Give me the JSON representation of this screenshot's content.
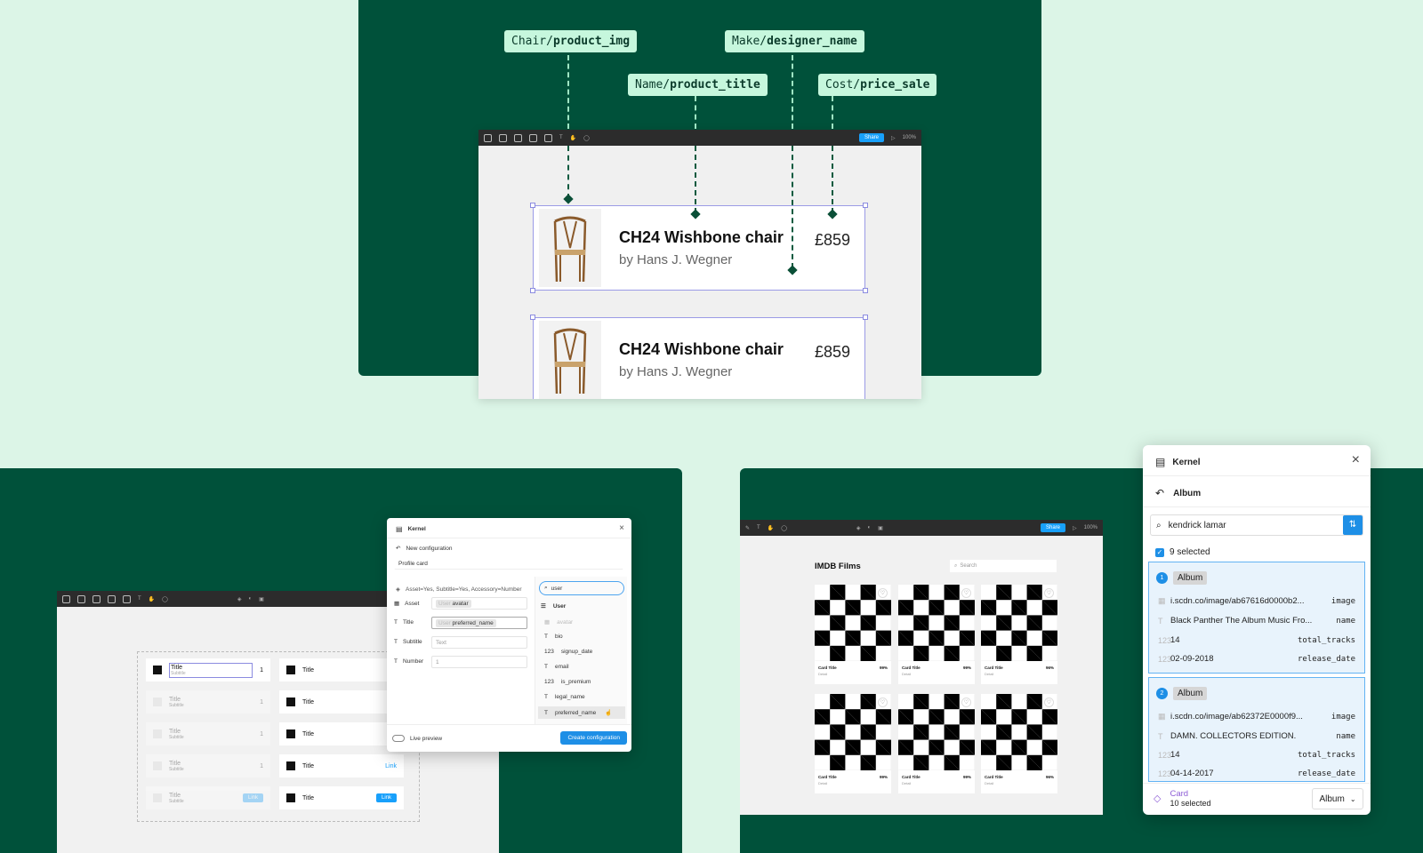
{
  "top": {
    "tags": {
      "product_img": {
        "prefix": "Chair/",
        "field": "product_img"
      },
      "designer_name": {
        "prefix": "Make/",
        "field": "designer_name"
      },
      "product_title": {
        "prefix": "Name/",
        "field": "product_title"
      },
      "price_sale": {
        "prefix": "Cost/",
        "field": "price_sale"
      }
    },
    "toolbar": {
      "share": "Share",
      "zoom": "100%"
    },
    "cards": [
      {
        "title": "CH24 Wishbone chair",
        "designer": "by Hans J. Wegner",
        "price": "£859"
      },
      {
        "title": "CH24 Wishbone chair",
        "designer": "by Hans J. Wegner",
        "price": "£859"
      }
    ]
  },
  "bottom_left": {
    "list": {
      "rows_left": [
        {
          "title": "Title",
          "subtitle": "Subtitle",
          "number": "1"
        },
        {
          "title": "Title",
          "subtitle": "Subtitle",
          "number": "1"
        },
        {
          "title": "Title",
          "subtitle": "Subtitle",
          "number": "1"
        },
        {
          "title": "Title",
          "subtitle": "Subtitle",
          "number": "1"
        },
        {
          "title": "Title",
          "subtitle": "Subtitle",
          "link": "Link"
        }
      ],
      "rows_right": [
        {
          "title": "Title"
        },
        {
          "title": "Title"
        },
        {
          "title": "Title"
        },
        {
          "title": "Title",
          "link": "Link"
        },
        {
          "title": "Title",
          "link": "Link"
        }
      ]
    },
    "kernel": {
      "title": "Kernel",
      "back_label": "New configuration",
      "config_name": "Profile card",
      "variant": "Asset=Yes, Subtitle=Yes, Accessory=Number",
      "fields": [
        {
          "label": "Asset",
          "chip_prefix": "User",
          "chip": "avatar"
        },
        {
          "label": "Title",
          "chip_prefix": "User",
          "chip": "preferred_name"
        },
        {
          "label": "Subtitle",
          "placeholder": "Text"
        },
        {
          "label": "Number",
          "placeholder": "1"
        }
      ],
      "search_value": "user",
      "group": "User",
      "properties": [
        {
          "icon": "▦",
          "name": "avatar",
          "dim": true
        },
        {
          "icon": "T",
          "name": "bio"
        },
        {
          "icon": "123",
          "name": "signup_date"
        },
        {
          "icon": "T",
          "name": "email"
        },
        {
          "icon": "123",
          "name": "is_premium"
        },
        {
          "icon": "T",
          "name": "legal_name"
        },
        {
          "icon": "T",
          "name": "preferred_name"
        }
      ],
      "live_preview": "Live preview",
      "create": "Create configuration"
    }
  },
  "bottom_right": {
    "window": {
      "title": "IMDB Films",
      "search_placeholder": "Search",
      "share": "Share",
      "zoom": "100%"
    },
    "films": [
      {
        "title": "Card Title",
        "sub": "Detail",
        "pct": "99%"
      },
      {
        "title": "Card Title",
        "sub": "Detail",
        "pct": "99%"
      },
      {
        "title": "Card Title",
        "sub": "Detail",
        "pct": "96%"
      },
      {
        "title": "Card Title",
        "sub": "Detail",
        "pct": "99%"
      },
      {
        "title": "Card Title",
        "sub": "Detail",
        "pct": "99%"
      },
      {
        "title": "Card Title",
        "sub": "Detail",
        "pct": "96%"
      }
    ],
    "kernel": {
      "title": "Kernel",
      "back_label": "Album",
      "search_value": "kendrick lamar",
      "selected": "9 selected",
      "records": [
        {
          "num": "1",
          "type": "Album",
          "rows": [
            {
              "icon": "▦",
              "value": "i.scdn.co/image/ab67616d0000b2...",
              "field": "image"
            },
            {
              "icon": "T",
              "value": "Black Panther The Album Music Fro...",
              "field": "name"
            },
            {
              "icon": "123",
              "value": "14",
              "field": "total_tracks"
            },
            {
              "icon": "123",
              "value": "02-09-2018",
              "field": "release_date"
            }
          ]
        },
        {
          "num": "2",
          "type": "Album",
          "rows": [
            {
              "icon": "▦",
              "value": "i.scdn.co/image/ab62372E0000f9...",
              "field": "image"
            },
            {
              "icon": "T",
              "value": "DAMN. COLLECTORS EDITION.",
              "field": "name"
            },
            {
              "icon": "123",
              "value": "14",
              "field": "total_tracks"
            },
            {
              "icon": "123",
              "value": "04-14-2017",
              "field": "release_date"
            }
          ]
        }
      ],
      "footer": {
        "label": "Card",
        "count": "10 selected",
        "dropdown": "Album"
      }
    }
  },
  "colors": {
    "panel": "#00513a",
    "background": "#dcf5e7",
    "tag": "#c6f7dd",
    "accent": "#18a0fb"
  }
}
